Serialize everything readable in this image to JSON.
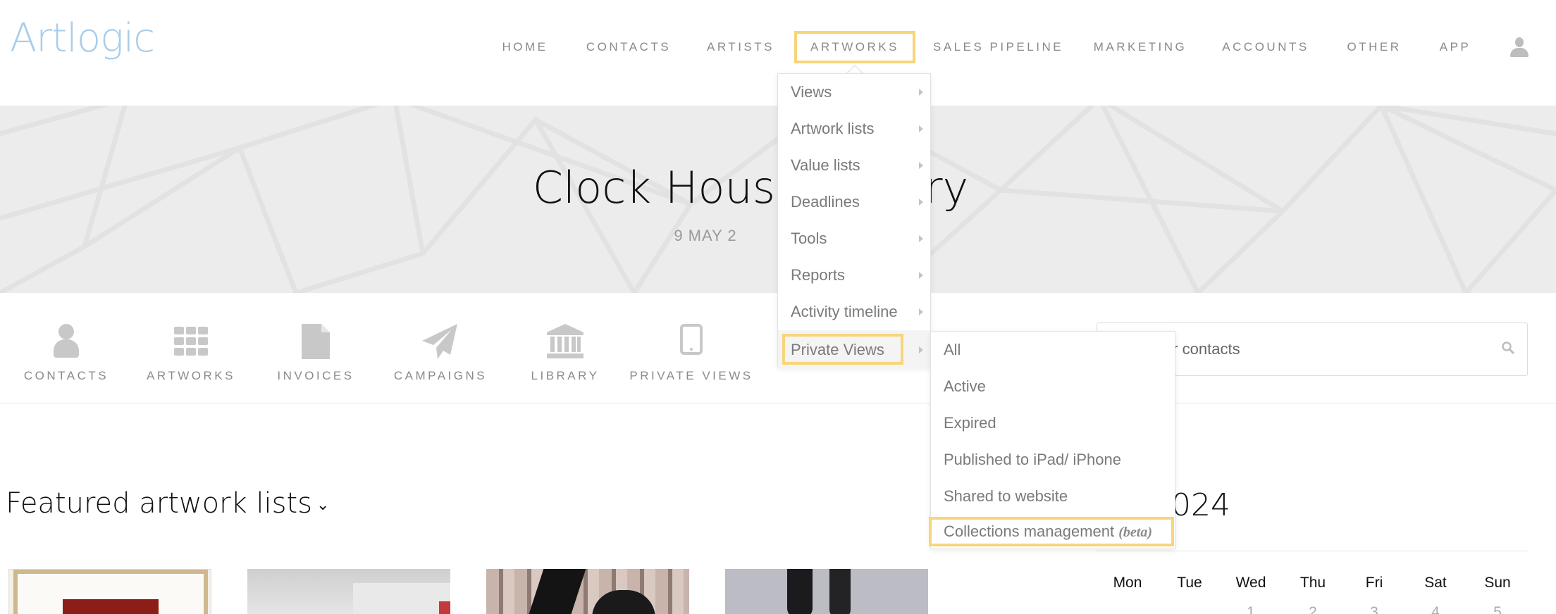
{
  "brand": {
    "logo_text": "Artlogic",
    "logo_color": "#a9cdea"
  },
  "nav": {
    "items": [
      {
        "label": "HOME"
      },
      {
        "label": "CONTACTS"
      },
      {
        "label": "ARTISTS"
      },
      {
        "label": "ARTWORKS",
        "highlighted": true
      },
      {
        "label": "SALES PIPELINE"
      },
      {
        "label": "MARKETING"
      },
      {
        "label": "ACCOUNTS"
      },
      {
        "label": "OTHER"
      },
      {
        "label": "APP"
      }
    ],
    "user_icon": "user-icon"
  },
  "hero": {
    "title_left": "Clock Hous",
    "title_right": "ry",
    "date": "9 MAY 2"
  },
  "quick_links": [
    {
      "label": "CONTACTS",
      "icon": "person-icon"
    },
    {
      "label": "ARTWORKS",
      "icon": "grid-icon"
    },
    {
      "label": "INVOICES",
      "icon": "document-icon"
    },
    {
      "label": "CAMPAIGNS",
      "icon": "paper-plane-icon"
    },
    {
      "label": "LIBRARY",
      "icon": "library-icon"
    },
    {
      "label": "PRIVATE VIEWS",
      "icon": "tablet-icon"
    }
  ],
  "search": {
    "value": "rtworks or contacts",
    "icon": "search-icon"
  },
  "featured": {
    "title": "Featured artwork lists",
    "chevron": "⌄"
  },
  "calendar": {
    "year_fragment": "024",
    "days": [
      "Mon",
      "Tue",
      "Wed",
      "Thu",
      "Fri",
      "Sat",
      "Sun"
    ],
    "first_row": [
      "1",
      "2",
      "3",
      "4",
      "5"
    ]
  },
  "artworks_menu": {
    "items": [
      {
        "label": "Views"
      },
      {
        "label": "Artwork lists"
      },
      {
        "label": "Value lists"
      },
      {
        "label": "Deadlines"
      },
      {
        "label": "Tools"
      },
      {
        "label": "Reports"
      },
      {
        "label": "Activity timeline"
      },
      {
        "label": "Private Views",
        "active": true
      }
    ]
  },
  "private_views_menu": {
    "items": [
      {
        "label": "All"
      },
      {
        "label": "Active"
      },
      {
        "label": "Expired"
      },
      {
        "label": "Published to iPad/ iPhone"
      },
      {
        "label": "Shared to website"
      },
      {
        "label": "Collections management",
        "suffix": "(beta)",
        "highlighted": true
      }
    ]
  },
  "colors": {
    "highlight": "#f7d57a",
    "nav_text": "#8a8a8a",
    "hero_bg": "#ececec"
  }
}
